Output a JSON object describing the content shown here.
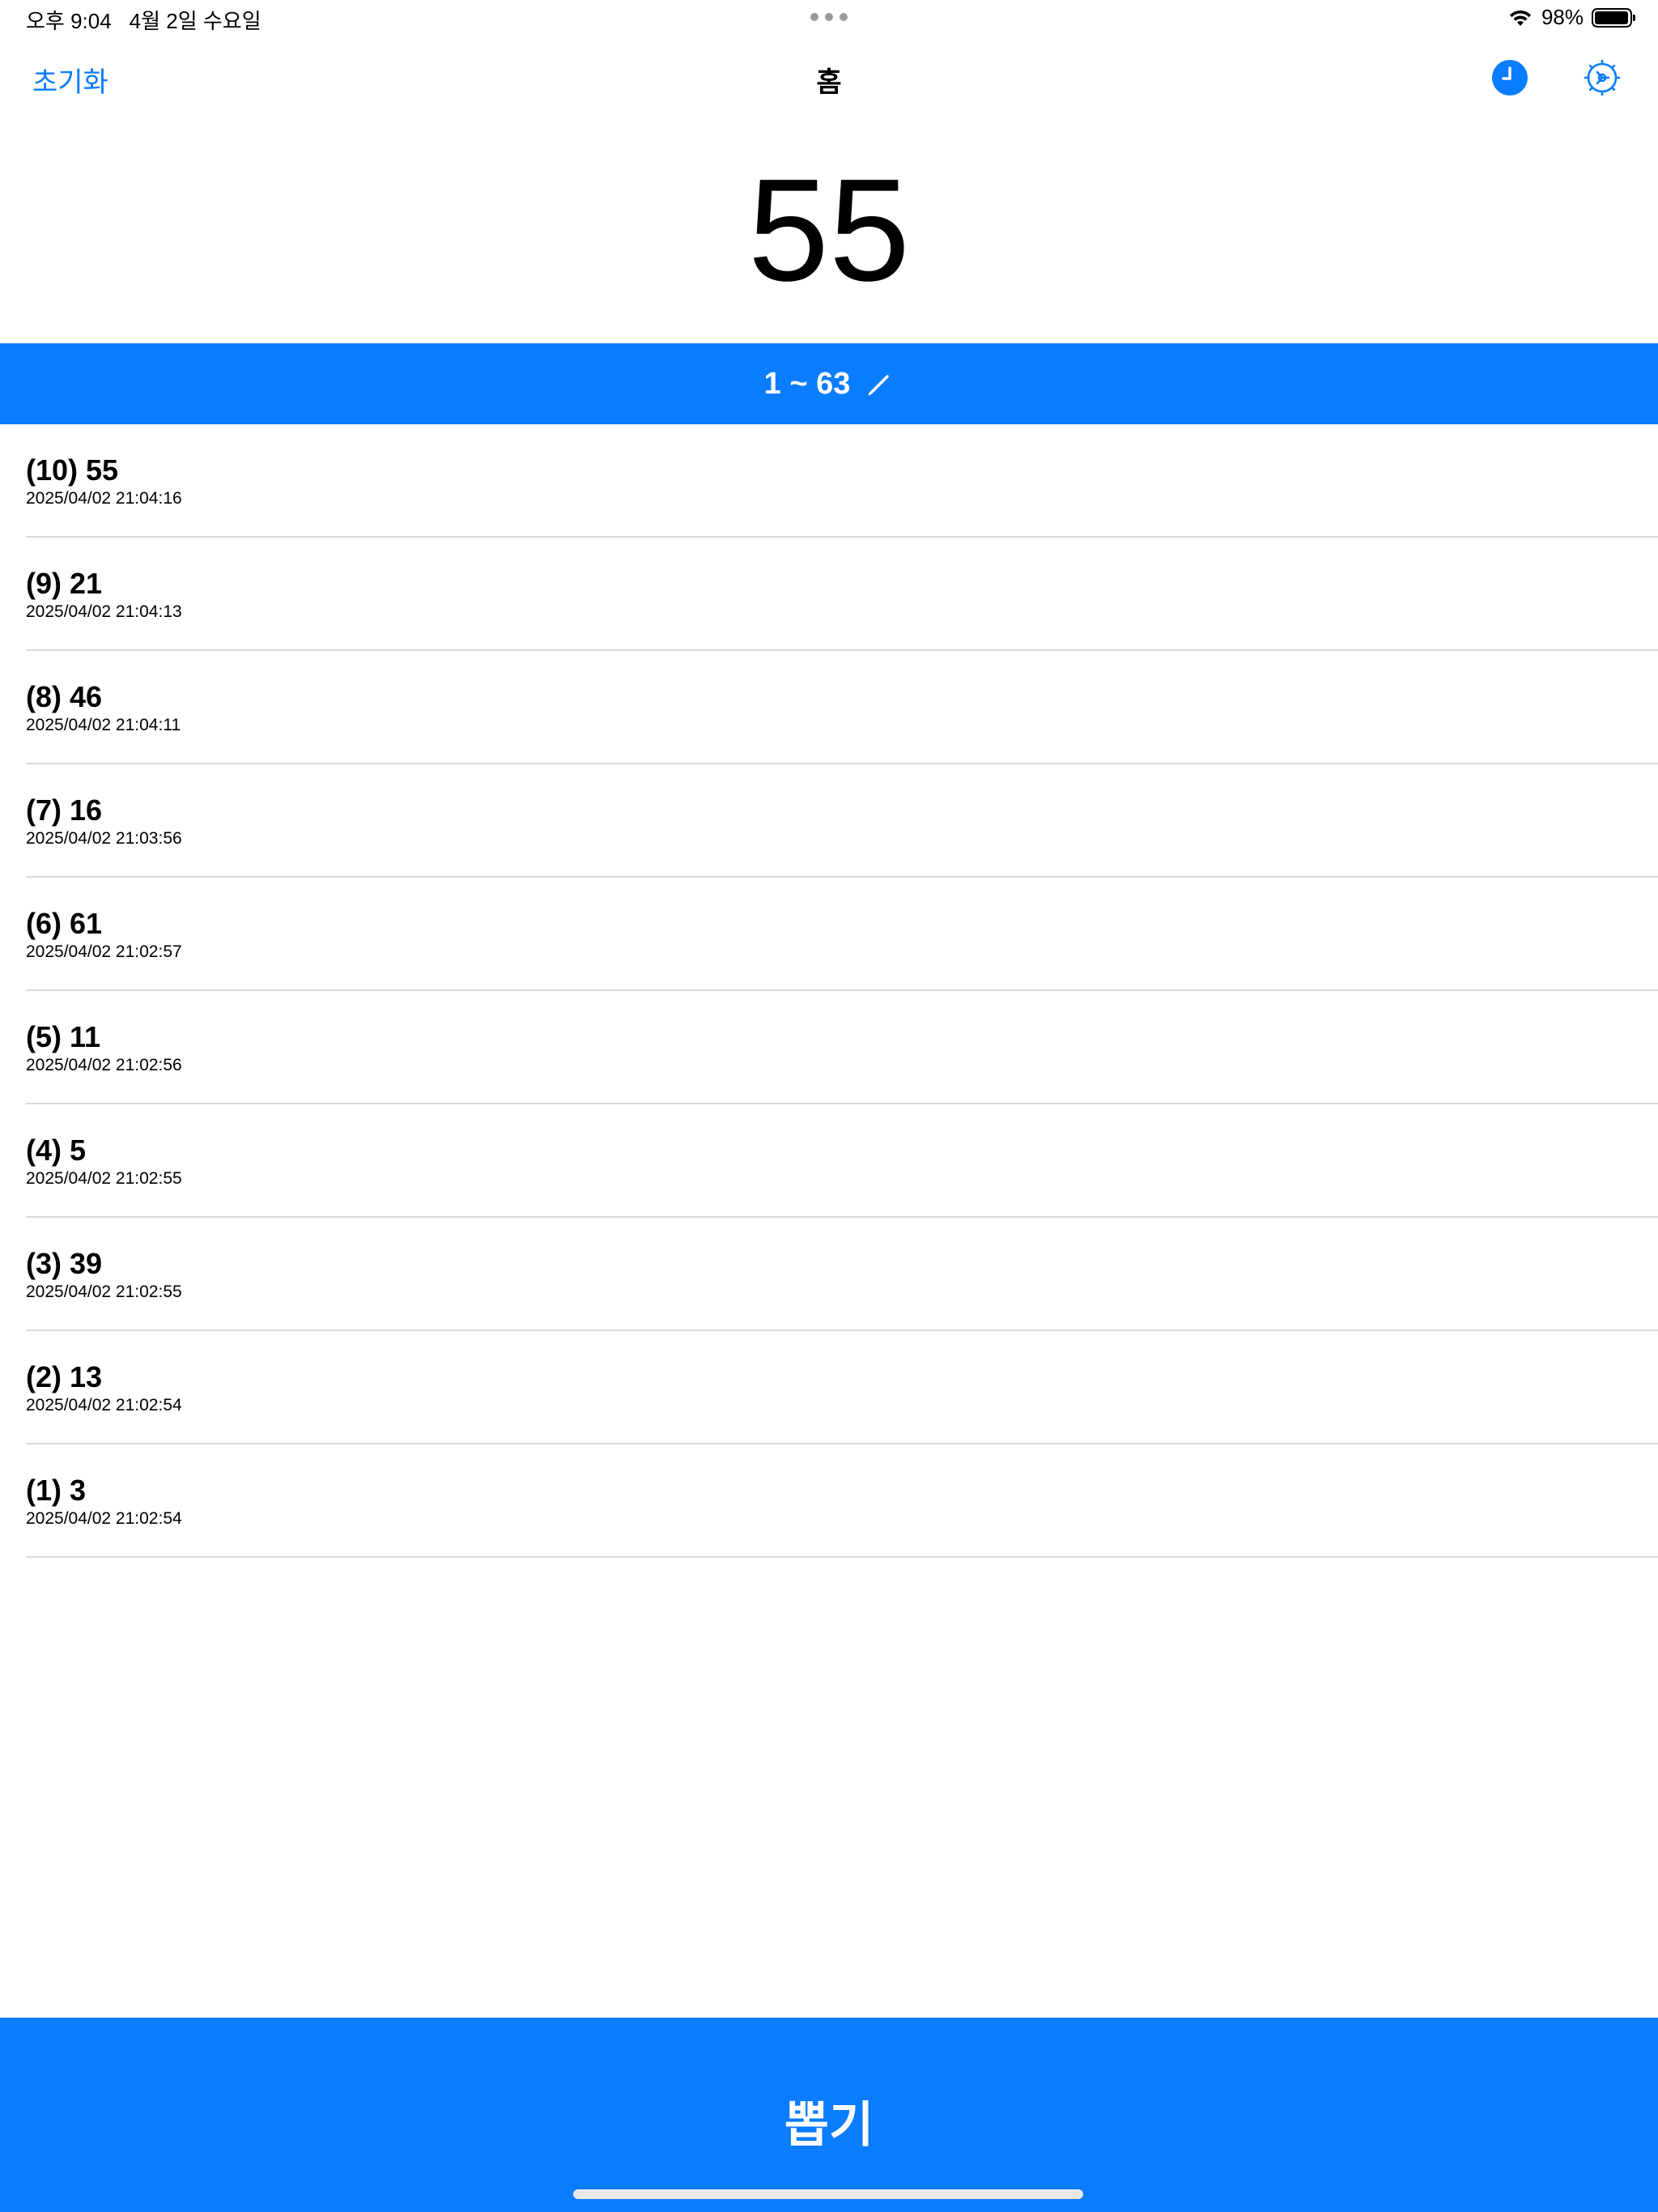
{
  "status_bar": {
    "time": "오후 9:04",
    "date": "4월 2일 수요일",
    "battery": "98%",
    "battery_level": 0.98
  },
  "nav": {
    "reset_label": "초기화",
    "title": "홈",
    "history_icon": "clock-icon",
    "settings_icon": "gear-icon"
  },
  "result": {
    "value": "55"
  },
  "range": {
    "label": "1 ~ 63",
    "edit_icon": "pencil-icon"
  },
  "history": [
    {
      "label": "(10) 55",
      "time": "2025/04/02 21:04:16"
    },
    {
      "label": "(9) 21",
      "time": "2025/04/02 21:04:13"
    },
    {
      "label": "(8) 46",
      "time": "2025/04/02 21:04:11"
    },
    {
      "label": "(7) 16",
      "time": "2025/04/02 21:03:56"
    },
    {
      "label": "(6) 61",
      "time": "2025/04/02 21:02:57"
    },
    {
      "label": "(5) 11",
      "time": "2025/04/02 21:02:56"
    },
    {
      "label": "(4) 5",
      "time": "2025/04/02 21:02:55"
    },
    {
      "label": "(3) 39",
      "time": "2025/04/02 21:02:55"
    },
    {
      "label": "(2) 13",
      "time": "2025/04/02 21:02:54"
    },
    {
      "label": "(1) 3",
      "time": "2025/04/02 21:02:54"
    }
  ],
  "draw_button": {
    "label": "뽑기"
  },
  "colors": {
    "accent": "#0a7cff",
    "divider": "#d9d9d9"
  }
}
